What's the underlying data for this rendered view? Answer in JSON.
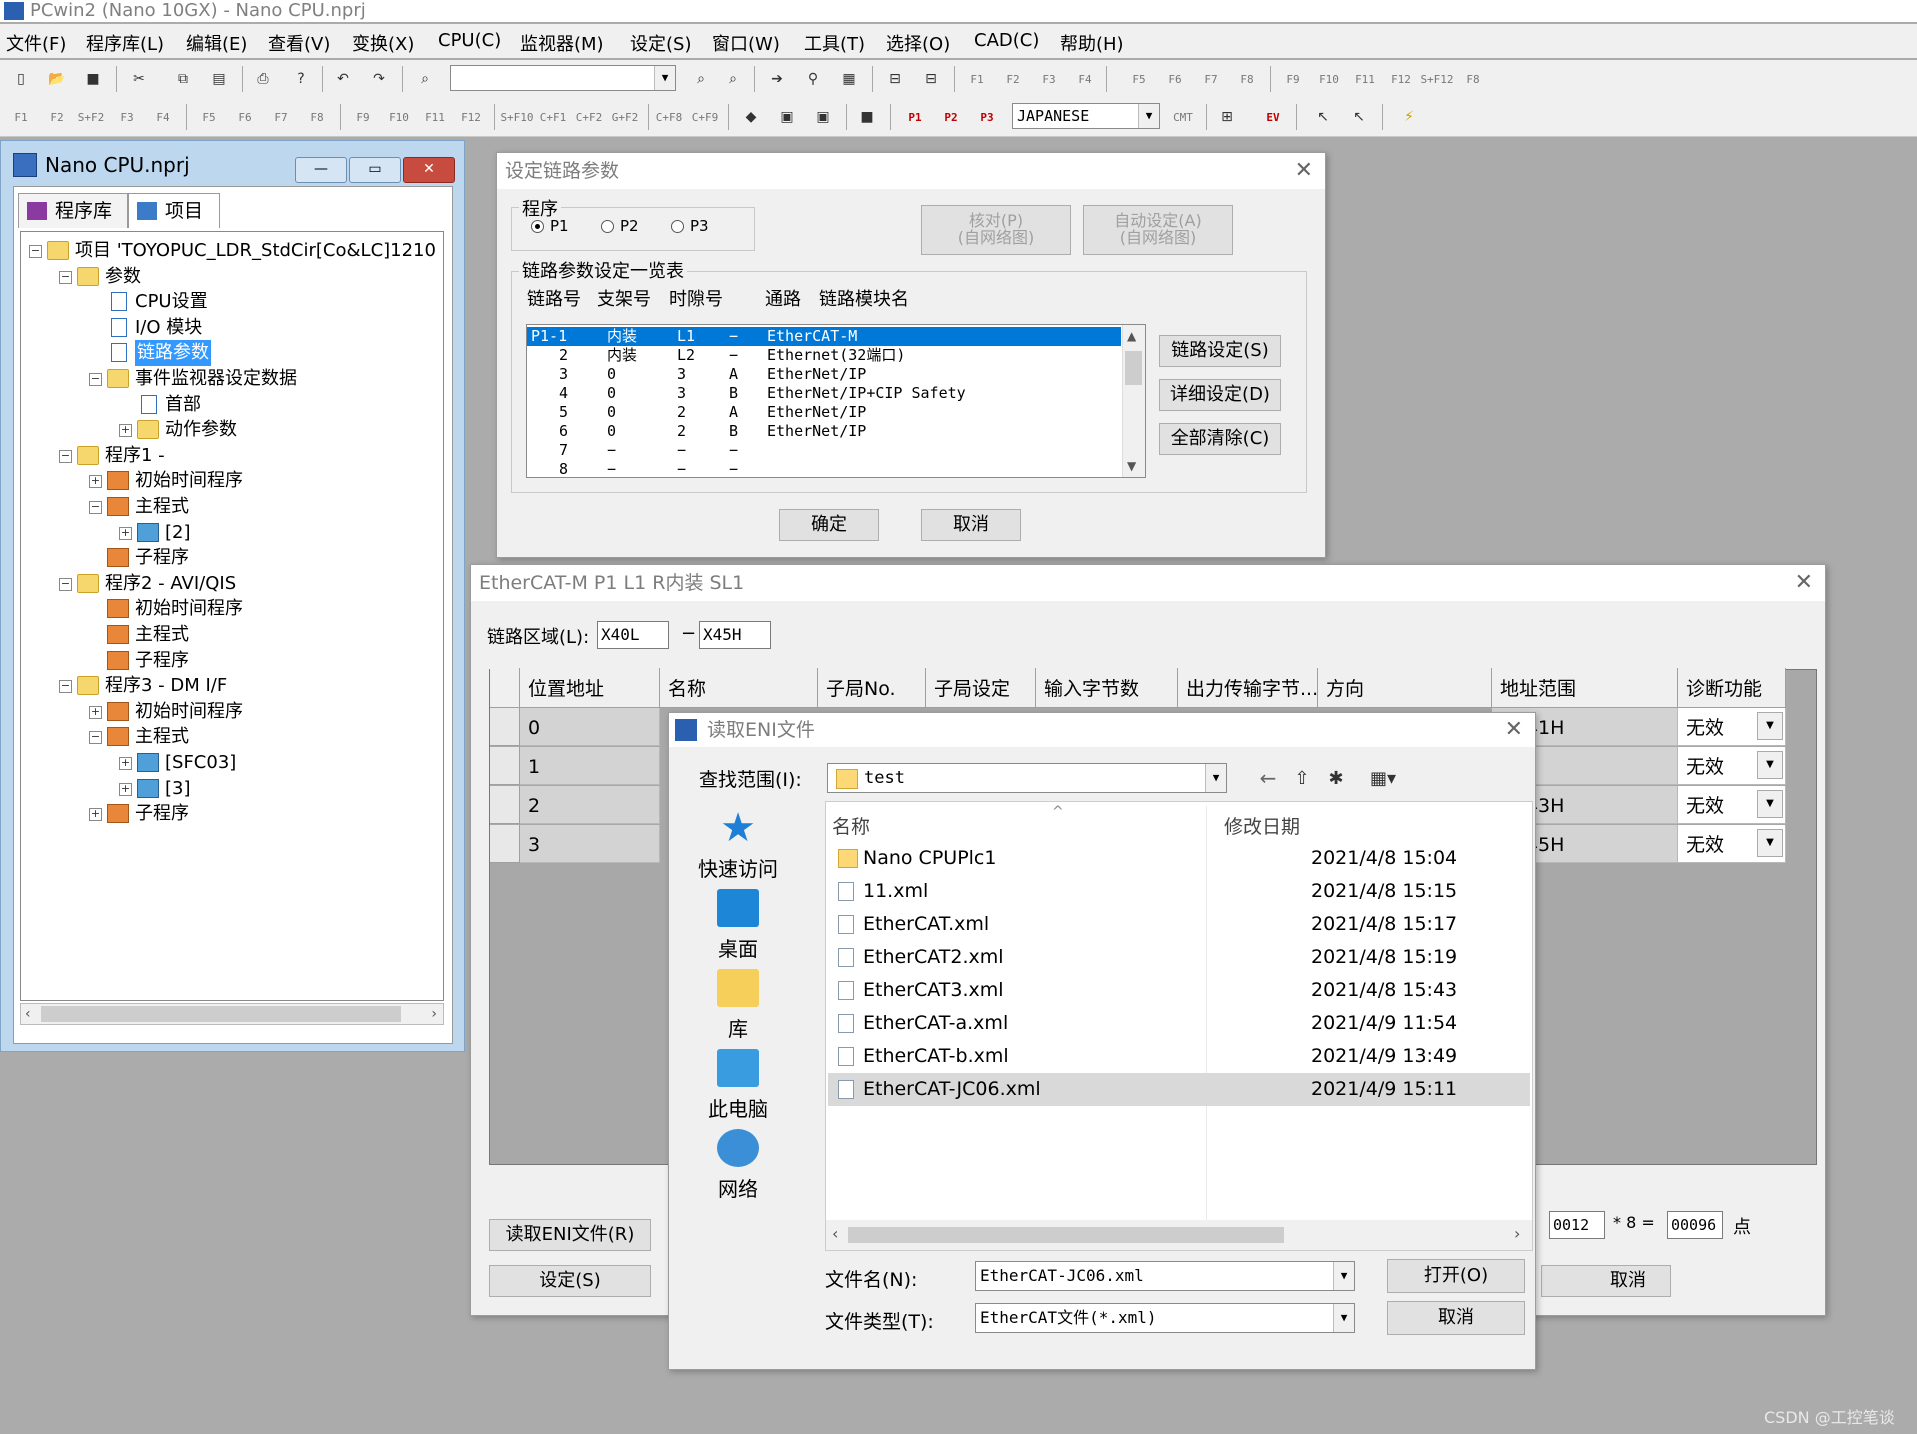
{
  "app": {
    "title": "PCwin2 (Nano 10GX)  - Nano CPU.nprj"
  },
  "menubar": [
    "文件(F)",
    "程序库(L)",
    "编辑(E)",
    "查看(V)",
    "变换(X)",
    "CPU(C)",
    "监视器(M)",
    "设定(S)",
    "窗口(W)",
    "工具(T)",
    "选择(O)",
    "CAD(C)",
    "帮助(H)"
  ],
  "toolbar": {
    "fkeys_row1": [
      "F1",
      "F2",
      "F3",
      "F4",
      "F5",
      "F6",
      "F7",
      "F8",
      "F9",
      "F10",
      "F11",
      "F12",
      "S+F12",
      "F8"
    ],
    "fkeys_row2": [
      "F1",
      "F2",
      "S+F2",
      "F3",
      "F4",
      "F5",
      "F6",
      "F7",
      "F8",
      "F9",
      "F10",
      "F11",
      "F12",
      "S+F10",
      "C+F1",
      "C+F2",
      "G+F2",
      "C+F8",
      "C+F9"
    ],
    "p_buttons": [
      "P1",
      "P2",
      "P3"
    ],
    "language_value": "JAPANESE",
    "cmt_label": "CMT",
    "ev_label": "EV"
  },
  "project_window": {
    "title": "Nano CPU.nprj",
    "tabs": [
      "程序库",
      "项目"
    ],
    "tree": [
      {
        "label": "项目 'TOYOPUC_LDR_StdCir[Co&LC]1210",
        "level": 0,
        "icon": "folder-icon",
        "exp": "−"
      },
      {
        "label": "参数",
        "level": 1,
        "icon": "folder-icon",
        "exp": "−"
      },
      {
        "label": "CPU设置",
        "level": 2,
        "icon": "page-icon",
        "exp": ""
      },
      {
        "label": "I/O 模块",
        "level": 2,
        "icon": "page-icon",
        "exp": ""
      },
      {
        "label": "链路参数",
        "level": 2,
        "icon": "page-icon",
        "exp": "",
        "selected": true
      },
      {
        "label": "事件监视器设定数据",
        "level": 2,
        "icon": "folder-icon",
        "exp": "−"
      },
      {
        "label": "首部",
        "level": 3,
        "icon": "page-icon",
        "exp": ""
      },
      {
        "label": "动作参数",
        "level": 3,
        "icon": "folder-icon",
        "exp": "+"
      },
      {
        "label": "程序1 -",
        "level": 1,
        "icon": "folder-icon",
        "exp": "−"
      },
      {
        "label": "初始时间程序",
        "level": 2,
        "icon": "program-icon",
        "exp": "+"
      },
      {
        "label": "主程式",
        "level": 2,
        "icon": "program-icon",
        "exp": "−"
      },
      {
        "label": "[2]",
        "level": 3,
        "icon": "ladder-icon",
        "exp": "+"
      },
      {
        "label": "子程序",
        "level": 2,
        "icon": "program-icon",
        "exp": ""
      },
      {
        "label": "程序2 - AVI/QIS",
        "level": 1,
        "icon": "folder-icon",
        "exp": "−"
      },
      {
        "label": "初始时间程序",
        "level": 2,
        "icon": "program-icon",
        "exp": ""
      },
      {
        "label": "主程式",
        "level": 2,
        "icon": "program-icon",
        "exp": ""
      },
      {
        "label": "子程序",
        "level": 2,
        "icon": "program-icon",
        "exp": ""
      },
      {
        "label": "程序3 - DM I/F",
        "level": 1,
        "icon": "folder-icon",
        "exp": "−"
      },
      {
        "label": "初始时间程序",
        "level": 2,
        "icon": "program-icon",
        "exp": "+"
      },
      {
        "label": "主程式",
        "level": 2,
        "icon": "program-icon",
        "exp": "−"
      },
      {
        "label": "[SFC03]",
        "level": 3,
        "icon": "ladder-icon",
        "exp": "+"
      },
      {
        "label": "[3]",
        "level": 3,
        "icon": "ladder-icon",
        "exp": "+"
      },
      {
        "label": "子程序",
        "level": 2,
        "icon": "program-icon",
        "exp": "+"
      }
    ]
  },
  "link_dialog": {
    "title": "设定链路参数",
    "program_group": "程序",
    "radios": [
      {
        "label": "P1",
        "checked": true
      },
      {
        "label": "P2",
        "checked": false
      },
      {
        "label": "P3",
        "checked": false
      }
    ],
    "check_button": {
      "line1": "核对(P)",
      "line2": "(自网络图)"
    },
    "auto_button": {
      "line1": "自动设定(A)",
      "line2": "(自网络图)"
    },
    "list_group": "链路参数设定一览表",
    "columns": [
      "链路号",
      "支架号",
      "时隙号",
      "通路",
      "链路模块名"
    ],
    "rows": [
      [
        "P1-1",
        "内装",
        "L1",
        "−",
        "EtherCAT-M"
      ],
      [
        "2",
        "内装",
        "L2",
        "−",
        "Ethernet(32端口)"
      ],
      [
        "3",
        "0",
        "3",
        "A",
        "EtherNet/IP"
      ],
      [
        "4",
        "0",
        "3",
        "B",
        "EtherNet/IP+CIP Safety"
      ],
      [
        "5",
        "0",
        "2",
        "A",
        "EtherNet/IP"
      ],
      [
        "6",
        "0",
        "2",
        "B",
        "EtherNet/IP"
      ],
      [
        "7",
        "−",
        "−",
        "−",
        ""
      ],
      [
        "8",
        "−",
        "−",
        "−",
        ""
      ]
    ],
    "side_buttons": [
      "链路设定(S)",
      "详细设定(D)",
      "全部清除(C)"
    ],
    "ok": "确定",
    "cancel": "取消"
  },
  "ethercat_dialog": {
    "title": "EtherCAT-M  P1 L1 R内装 SL1",
    "area_label": "链路区域(L):",
    "area_from": "X40L",
    "area_dash": "−",
    "area_to": "X45H",
    "columns": [
      "位置地址",
      "名称",
      "子局No.",
      "子局设定",
      "输入字节数",
      "出力传输字节...",
      "方向",
      "地址范围",
      "诊断功能"
    ],
    "rows": [
      {
        "pos": "0",
        "range": "- X41H",
        "diag": "无效"
      },
      {
        "pos": "1",
        "range": "",
        "diag": "无效"
      },
      {
        "pos": "2",
        "range": "- X43H",
        "diag": "无效"
      },
      {
        "pos": "3",
        "range": "- X45H",
        "diag": "无效"
      }
    ],
    "calc_value1": "0012",
    "calc_mul": "* 8 =",
    "calc_value2": "00096",
    "calc_unit": "点",
    "read_eni_button": "读取ENI文件(R)",
    "set_button": "设定(S)",
    "cancel_button": "取消"
  },
  "file_dialog": {
    "title": "读取ENI文件",
    "look_in_label": "查找范围(I):",
    "look_in_value": "test",
    "nav": [
      "快速访问",
      "桌面",
      "库",
      "此电脑",
      "网络"
    ],
    "col_name": "名称",
    "col_date": "修改日期",
    "files": [
      {
        "name": "Nano CPUPlc1",
        "date": "2021/4/8 15:04",
        "type": "folder"
      },
      {
        "name": "11.xml",
        "date": "2021/4/8 15:15",
        "type": "xml"
      },
      {
        "name": "EtherCAT.xml",
        "date": "2021/4/8 15:17",
        "type": "xml"
      },
      {
        "name": "EtherCAT2.xml",
        "date": "2021/4/8 15:19",
        "type": "xml"
      },
      {
        "name": "EtherCAT3.xml",
        "date": "2021/4/8 15:43",
        "type": "xml"
      },
      {
        "name": "EtherCAT-a.xml",
        "date": "2021/4/9 11:54",
        "type": "xml"
      },
      {
        "name": "EtherCAT-b.xml",
        "date": "2021/4/9 13:49",
        "type": "xml"
      },
      {
        "name": "EtherCAT-JC06.xml",
        "date": "2021/4/9 15:11",
        "type": "xml",
        "selected": true
      }
    ],
    "filename_label": "文件名(N):",
    "filename_value": "EtherCAT-JC06.xml",
    "filetype_label": "文件类型(T):",
    "filetype_value": "EtherCAT文件(*.xml)",
    "open_button": "打开(O)",
    "cancel_button": "取消"
  },
  "watermark": "CSDN @工控笔谈"
}
